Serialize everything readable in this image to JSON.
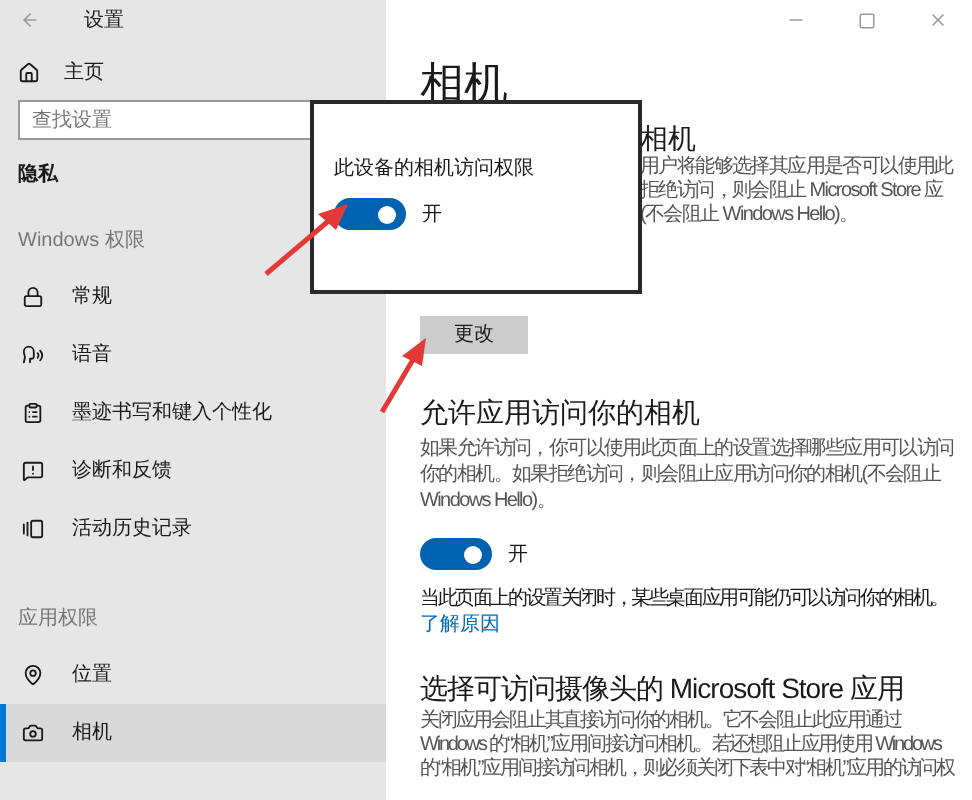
{
  "window": {
    "title": "设置"
  },
  "sidebar": {
    "home": "主页",
    "search": {
      "placeholder": "查找设置"
    },
    "section": "隐私",
    "groups": [
      {
        "title": "Windows 权限",
        "items": [
          {
            "label": "常规",
            "selected": false
          },
          {
            "label": "语音",
            "selected": false
          },
          {
            "label": "墨迹书写和键入个性化",
            "selected": false
          },
          {
            "label": "诊断和反馈",
            "selected": false
          },
          {
            "label": "活动历史记录",
            "selected": false
          }
        ]
      },
      {
        "title": "应用权限",
        "items": [
          {
            "label": "位置",
            "selected": false
          },
          {
            "label": "相机",
            "selected": true
          }
        ]
      }
    ]
  },
  "main": {
    "title": "相机",
    "device_section": {
      "heading": "相机",
      "lines": [
        "用户将能够选择其应用是否可以使用此",
        "拒绝访问，则会阻止 Microsoft Store 应",
        "(不会阻止 Windows Hello)。"
      ],
      "button": "更改"
    },
    "dialog": {
      "label": "此设备的相机访问权限",
      "toggle": {
        "on": true,
        "text": "开"
      }
    },
    "apps_section": {
      "heading": "允许应用访问你的相机",
      "description": "如果允许访问，你可以使用此页面上的设置选择哪些应用可以访问你的相机。如果拒绝访问，则会阻止应用访问你的相机(不会阻止 Windows Hello)。",
      "toggle": {
        "on": true,
        "text": "开"
      },
      "note": "当此页面上的设置关闭时，某些桌面应用可能仍可以访问你的相机。",
      "link": "了解原因"
    },
    "store_section": {
      "heading": "选择可访问摄像头的 Microsoft Store 应用",
      "description": "关闭应用会阻止其直接访问你的相机。它不会阻止此应用通过 Windows 的“相机”应用间接访问相机。若还想阻止应用使用 Windows 的“相机”应用间接访问相机，则必须关闭下表中对“相机”应用的访问权"
    }
  }
}
